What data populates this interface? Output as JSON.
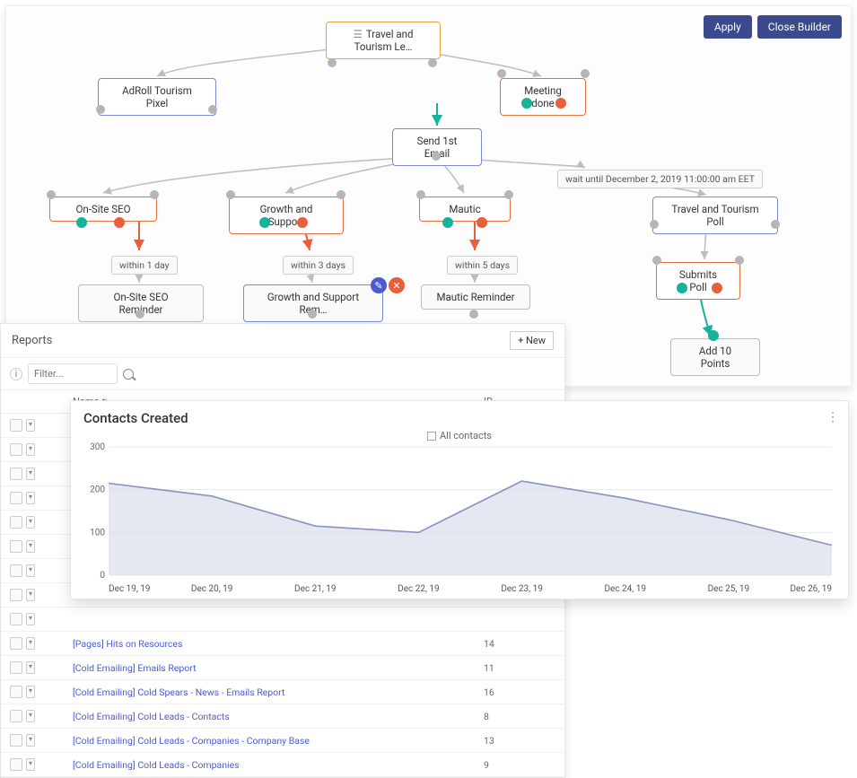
{
  "builder": {
    "apply": "Apply",
    "close": "Close Builder",
    "root": "Travel and Tourism Le…",
    "adroll": "AdRoll Tourism Pixel",
    "meeting": "Meeting done",
    "send1": "Send 1st Email",
    "wait": "wait until December 2, 2019 11:00:00 am EET",
    "poll": "Travel and Tourism Poll",
    "submits": "Submits Poll",
    "add10": "Add 10 Points",
    "seo": "On-Site SEO",
    "growth": "Growth and Support",
    "mautic": "Mautic",
    "w1": "within 1 day",
    "w3": "within 3 days",
    "w5": "within 5 days",
    "seoRem": "On-Site SEO Reminder",
    "growthRem": "Growth and Support Rem…",
    "mauticRem": "Mautic Reminder"
  },
  "reports": {
    "title": "Reports",
    "newBtn": "+ New",
    "filterPlaceholder": "Filter...",
    "colName": "Name",
    "colID": "ID",
    "rows": [
      {
        "name": "[Pages] Hits on Resources",
        "id": "14"
      },
      {
        "name": "[Cold Emailing] Emails Report",
        "id": "11"
      },
      {
        "name": "[Cold Emailing] Cold Spears - News - Emails Report",
        "id": "16"
      },
      {
        "name": "[Cold Emailing] Cold Leads - Contacts",
        "id": "8"
      },
      {
        "name": "[Cold Emailing] Cold Leads - Companies - Company Base",
        "id": "13"
      },
      {
        "name": "[Cold Emailing] Cold Leads - Companies",
        "id": "9"
      }
    ],
    "blankRowsBefore": 9
  },
  "chart_data": {
    "type": "area",
    "title": "Contacts Created",
    "legend": "All contacts",
    "ylabel": "",
    "xlabel": "",
    "ylim": [
      0,
      300
    ],
    "x": [
      "Dec 19, 19",
      "Dec 20, 19",
      "Dec 21, 19",
      "Dec 22, 19",
      "Dec 23, 19",
      "Dec 24, 19",
      "Dec 25, 19",
      "Dec 26, 19"
    ],
    "series": [
      {
        "name": "All contacts",
        "values": [
          215,
          185,
          115,
          100,
          220,
          180,
          130,
          70
        ]
      }
    ]
  }
}
